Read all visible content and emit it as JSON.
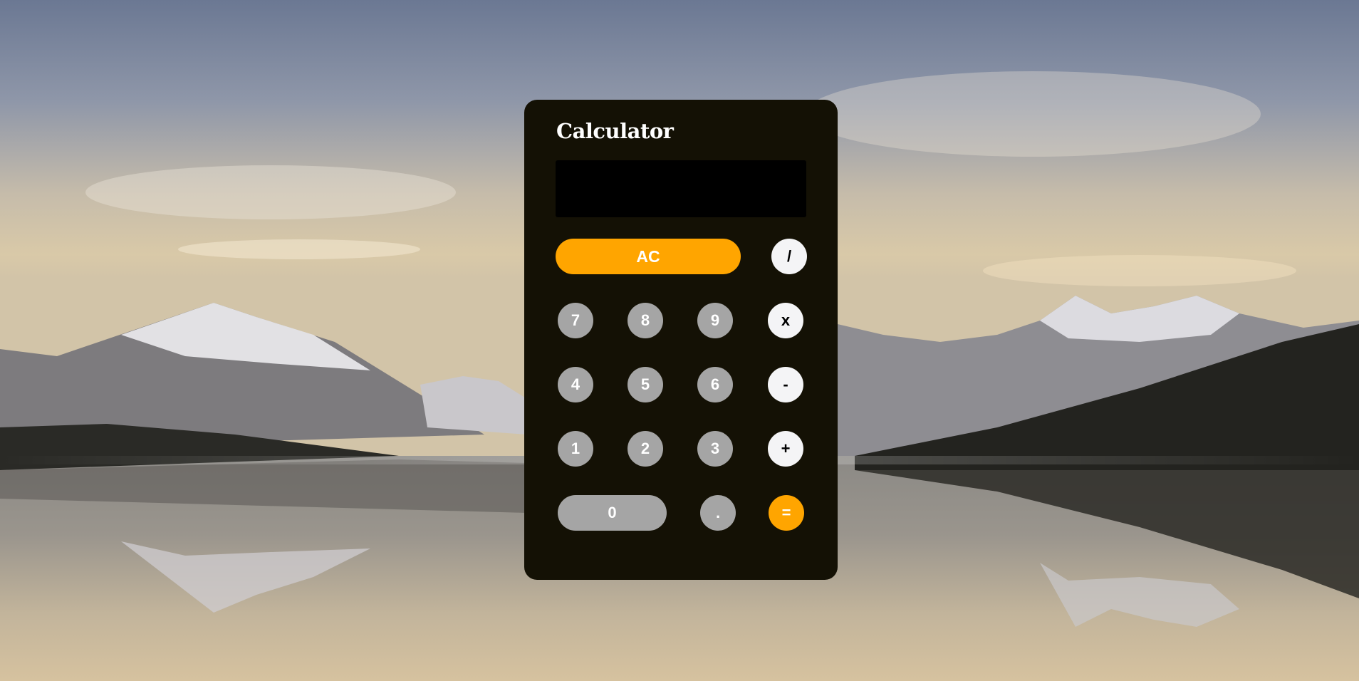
{
  "app": {
    "title": "Calculator"
  },
  "display": {
    "value": ""
  },
  "buttons": {
    "clear": "AC",
    "divide": "/",
    "multiply": "x",
    "subtract": "-",
    "add": "+",
    "equals": "=",
    "decimal": ".",
    "digits": {
      "d0": "0",
      "d1": "1",
      "d2": "2",
      "d3": "3",
      "d4": "4",
      "d5": "5",
      "d6": "6",
      "d7": "7",
      "d8": "8",
      "d9": "9"
    }
  },
  "colors": {
    "panel": "#141105",
    "display": "#000000",
    "accent": "#ffa500",
    "digit": "#a5a5a5",
    "operator": "#f4f4f6"
  }
}
